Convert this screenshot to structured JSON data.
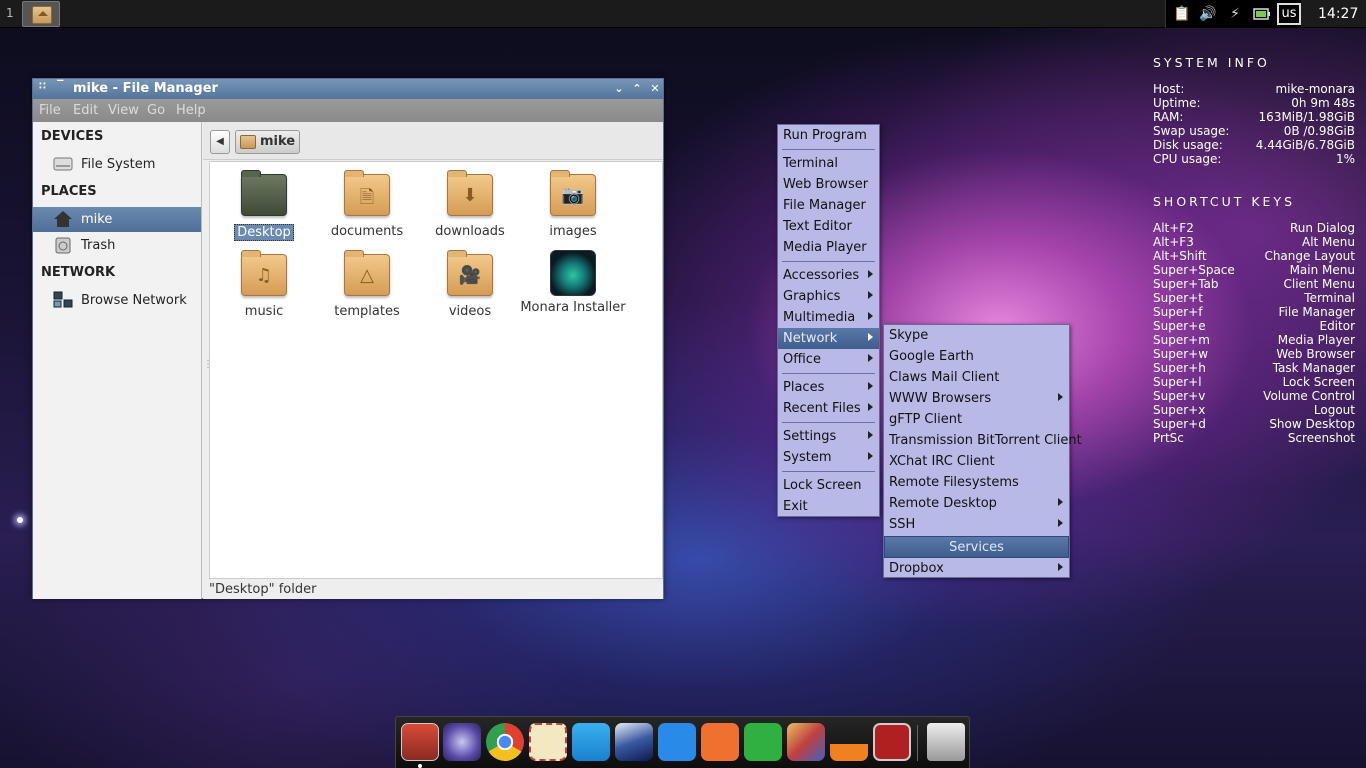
{
  "top_panel": {
    "workspace": "1",
    "keyboard_layout": "us",
    "clock": "14:27",
    "tray_icons": [
      "clipboard-icon",
      "volume-icon",
      "power-plug-icon",
      "battery-icon"
    ]
  },
  "file_manager": {
    "title": "mike - File Manager",
    "menu": [
      "File",
      "Edit",
      "View",
      "Go",
      "Help"
    ],
    "sidebar": {
      "devices_header": "DEVICES",
      "places_header": "PLACES",
      "network_header": "NETWORK",
      "devices": [
        {
          "label": "File System",
          "icon": "drive-icon"
        }
      ],
      "places": [
        {
          "label": "mike",
          "icon": "home-icon"
        },
        {
          "label": "Trash",
          "icon": "trash-icon"
        }
      ],
      "network": [
        {
          "label": "Browse Network",
          "icon": "network-icon"
        }
      ]
    },
    "breadcrumb": "mike",
    "files": [
      {
        "label": "Desktop",
        "icon": "folder-desktop-icon"
      },
      {
        "label": "documents",
        "icon": "folder-documents-icon"
      },
      {
        "label": "downloads",
        "icon": "folder-downloads-icon"
      },
      {
        "label": "images",
        "icon": "folder-images-icon"
      },
      {
        "label": "music",
        "icon": "folder-music-icon"
      },
      {
        "label": "templates",
        "icon": "folder-templates-icon"
      },
      {
        "label": "videos",
        "icon": "folder-videos-icon"
      },
      {
        "label": "Monara Installer",
        "icon": "monara-installer-icon"
      }
    ],
    "status": "\"Desktop\" folder"
  },
  "root_menu": {
    "items": [
      "Run Program",
      "Terminal",
      "Web Browser",
      "File Manager",
      "Text Editor",
      "Media Player",
      "Accessories",
      "Graphics",
      "Multimedia",
      "Network",
      "Office",
      "Places",
      "Recent Files",
      "Settings",
      "System",
      "Lock Screen",
      "Exit"
    ]
  },
  "network_menu": {
    "items": [
      "Skype",
      "Google Earth",
      "Claws Mail Client",
      "WWW Browsers",
      "gFTP Client",
      "Transmission BitTorrent Client",
      "XChat IRC Client",
      "Remote Filesystems",
      "Remote Desktop",
      "SSH"
    ],
    "header": "Services",
    "footer_item": "Dropbox"
  },
  "conky": {
    "system_info_title": "SYSTEM INFO",
    "system_info": [
      {
        "k": "Host:",
        "v": "mike-monara"
      },
      {
        "k": "Uptime:",
        "v": "0h 9m 48s"
      },
      {
        "k": "RAM:",
        "v": "163MiB/1.98GiB"
      },
      {
        "k": "Swap usage:",
        "v": "0B  /0.98GiB"
      },
      {
        "k": "Disk usage:",
        "v": "4.44GiB/6.78GiB"
      },
      {
        "k": "CPU usage:",
        "v": "1%"
      }
    ],
    "shortcuts_title": "SHORTCUT KEYS",
    "shortcuts": [
      {
        "k": "Alt+F2",
        "v": "Run Dialog"
      },
      {
        "k": "Alt+F3",
        "v": "Alt Menu"
      },
      {
        "k": "Alt+Shift",
        "v": "Change Layout"
      },
      {
        "k": "Super+Space",
        "v": "Main Menu"
      },
      {
        "k": "Super+Tab",
        "v": "Client Menu"
      },
      {
        "k": "Super+t",
        "v": "Terminal"
      },
      {
        "k": "Super+f",
        "v": "File Manager"
      },
      {
        "k": "Super+e",
        "v": "Editor"
      },
      {
        "k": "Super+m",
        "v": "Media Player"
      },
      {
        "k": "Super+w",
        "v": "Web Browser"
      },
      {
        "k": "Super+h",
        "v": "Task Manager"
      },
      {
        "k": "Super+l",
        "v": "Lock Screen"
      },
      {
        "k": "Super+v",
        "v": "Volume Control"
      },
      {
        "k": "Super+x",
        "v": "Logout"
      },
      {
        "k": "Super+d",
        "v": "Show Desktop"
      },
      {
        "k": "PrtSc",
        "v": "Screenshot"
      }
    ]
  },
  "dock": {
    "apps": [
      "installer-app-icon",
      "pidgin-app-icon",
      "chrome-app-icon",
      "mail-app-icon",
      "skype-app-icon",
      "google-earth-app-icon",
      "wps-writer-app-icon",
      "wps-presentation-app-icon",
      "wps-spreadsheet-app-icon",
      "gimp-app-icon",
      "vlc-app-icon",
      "task-manager-app-icon",
      "trash-app-icon"
    ]
  },
  "colors": {
    "selection": "#6a8ab0",
    "menu_bg": "#b9b9e8",
    "titlebar": "#53739a"
  }
}
